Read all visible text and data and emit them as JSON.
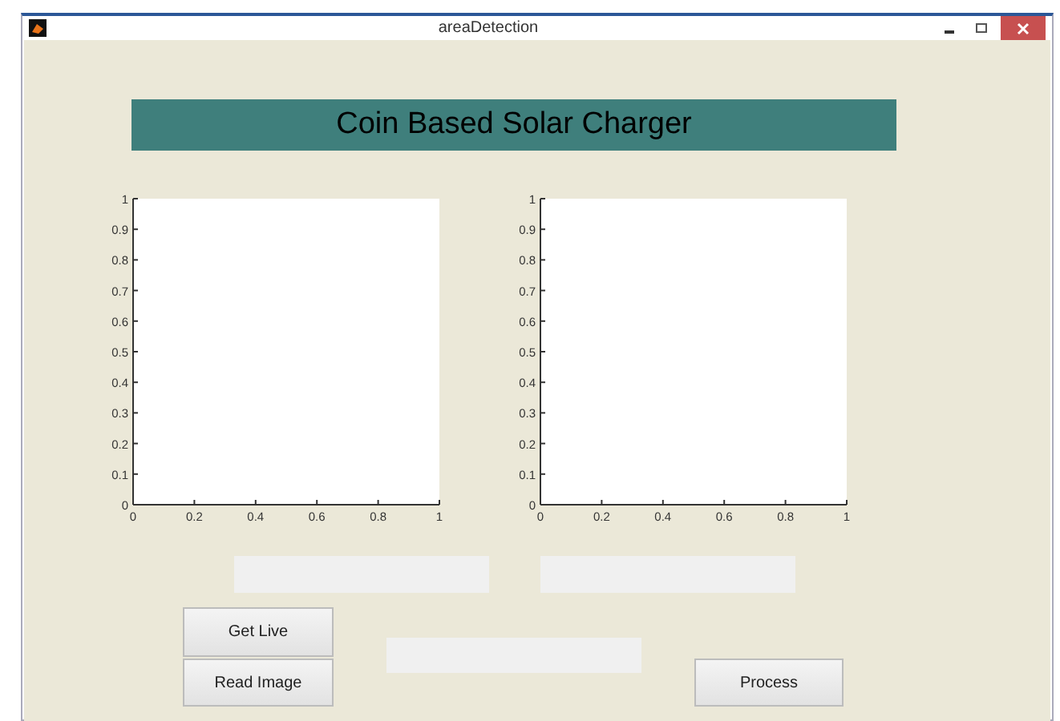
{
  "window": {
    "title": "areaDetection"
  },
  "banner": {
    "title": "Coin Based Solar Charger"
  },
  "axes": [
    {
      "chart_data": {
        "type": "line",
        "xlim": [
          0,
          1
        ],
        "ylim": [
          0,
          1
        ],
        "xticks": [
          0,
          0.2,
          0.4,
          0.6,
          0.8,
          1
        ],
        "yticks": [
          0,
          0.1,
          0.2,
          0.3,
          0.4,
          0.5,
          0.6,
          0.7,
          0.8,
          0.9,
          1
        ]
      }
    },
    {
      "chart_data": {
        "type": "line",
        "xlim": [
          0,
          1
        ],
        "ylim": [
          0,
          1
        ],
        "xticks": [
          0,
          0.2,
          0.4,
          0.6,
          0.8,
          1
        ],
        "yticks": [
          0,
          0.1,
          0.2,
          0.3,
          0.4,
          0.5,
          0.6,
          0.7,
          0.8,
          0.9,
          1
        ]
      }
    }
  ],
  "buttons": [
    {
      "kind": "get",
      "label": "Get Live"
    },
    {
      "kind": "read",
      "label": "Read Image"
    },
    {
      "kind": "process",
      "label": "Process"
    }
  ]
}
